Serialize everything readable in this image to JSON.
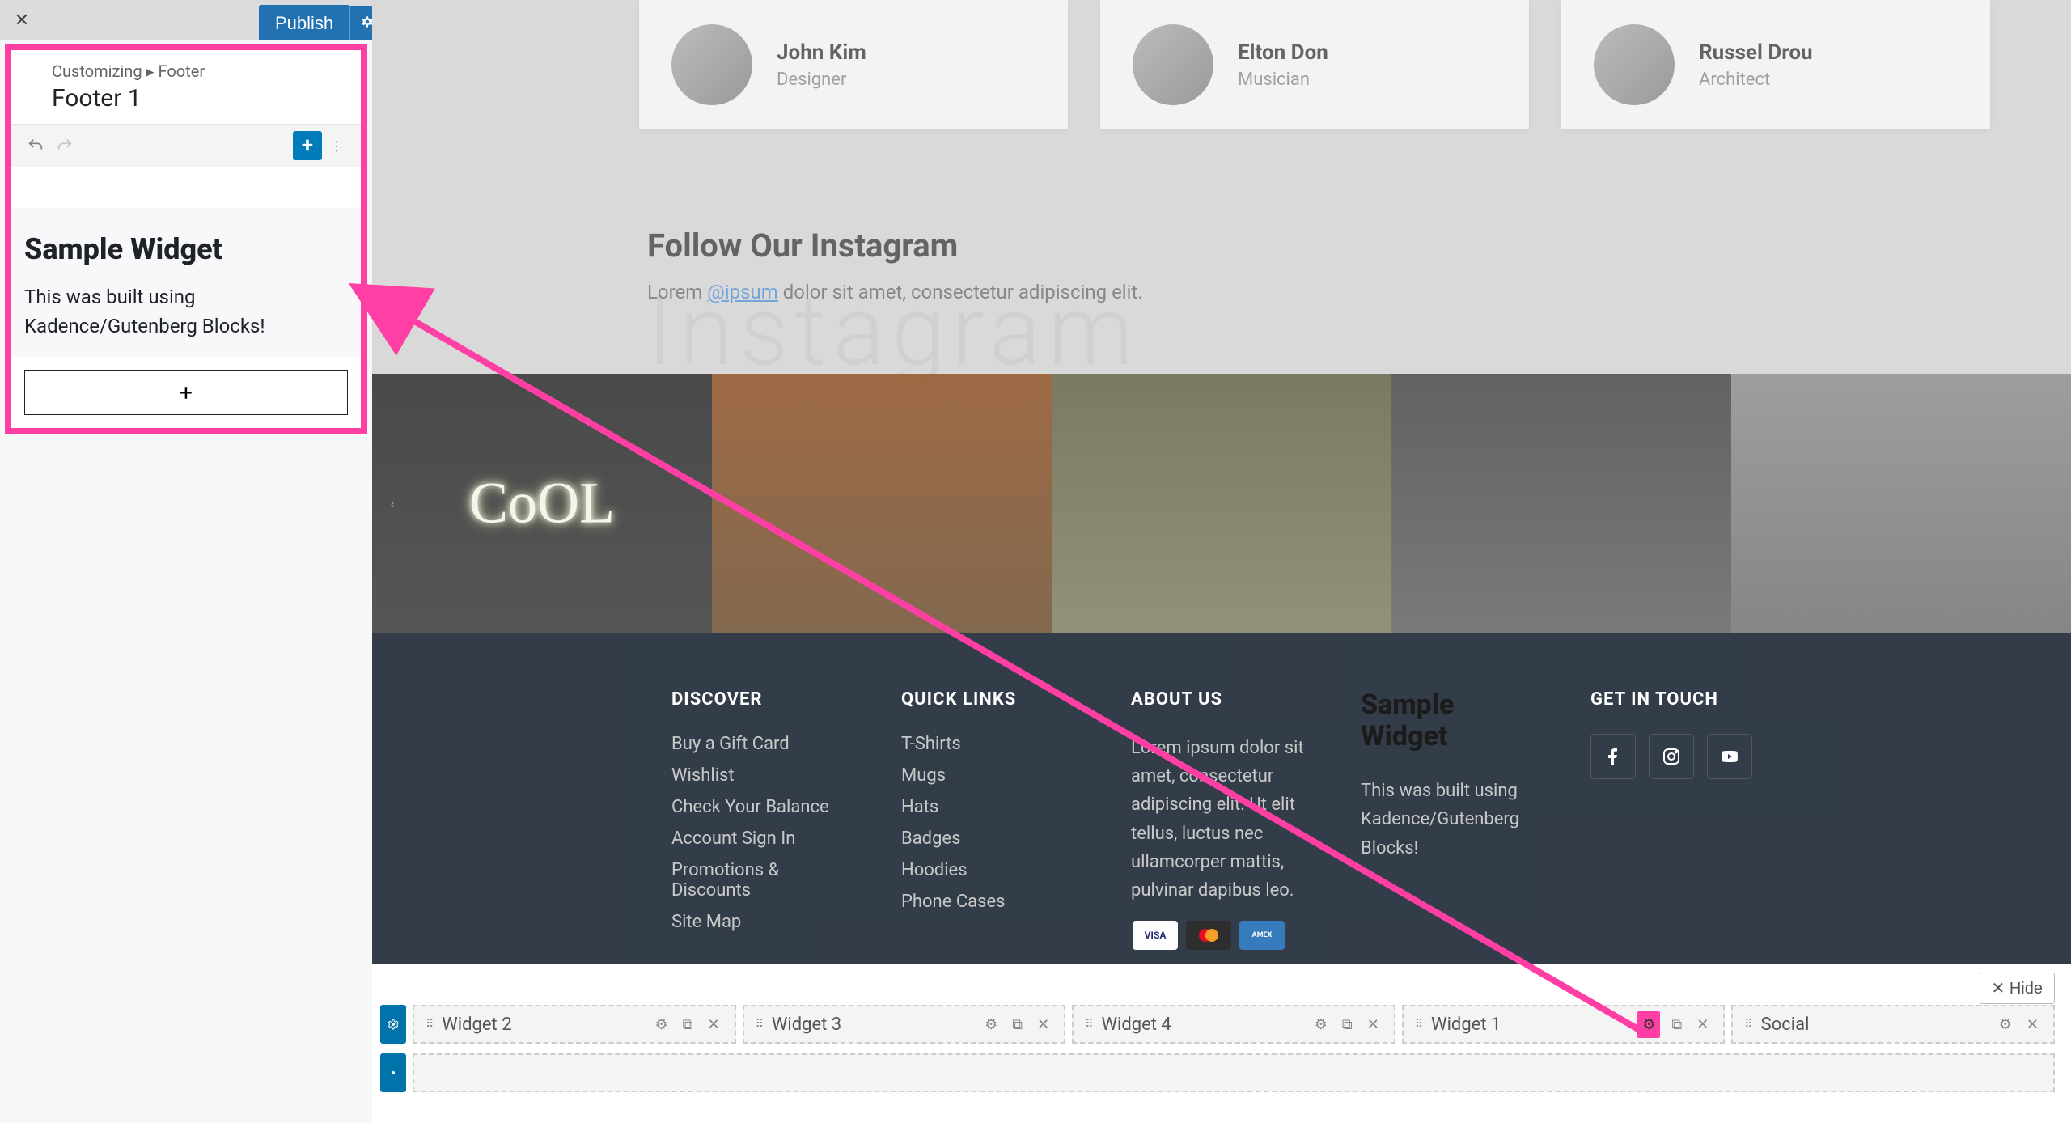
{
  "topbar": {
    "close": "✕",
    "publish": "Publish"
  },
  "sidebar": {
    "breadcrumb": "Customizing ▸ Footer",
    "title": "Footer 1",
    "widget_heading": "Sample Widget",
    "widget_body": "This was built using Kadence/Gutenberg Blocks!",
    "add_block": "+"
  },
  "team": [
    {
      "name": "John Kim",
      "role": "Designer"
    },
    {
      "name": "Elton Don",
      "role": "Musician"
    },
    {
      "name": "Russel Drou",
      "role": "Architect"
    }
  ],
  "instagram": {
    "heading": "Follow Our Instagram",
    "text_pre": "Lorem ",
    "link": "@ipsum",
    "text_post": " dolor sit amet, consectetur adipiscing elit.",
    "bg_text": "Instagram",
    "cool": "CoOL"
  },
  "footer": {
    "discover": {
      "title": "DISCOVER",
      "items": [
        "Buy a Gift Card",
        "Wishlist",
        "Check Your Balance",
        "Account Sign In",
        "Promotions & Discounts",
        "Site Map"
      ]
    },
    "quicklinks": {
      "title": "QUICK LINKS",
      "items": [
        "T-Shirts",
        "Mugs",
        "Hats",
        "Badges",
        "Hoodies",
        "Phone Cases"
      ]
    },
    "about": {
      "title": "ABOUT US",
      "text": "Lorem ipsum dolor sit amet, consectetur adipiscing elit. Ut elit tellus, luctus nec ullamcorper mattis, pulvinar dapibus leo."
    },
    "sample": {
      "title": "Sample Widget",
      "text": "This was built using Kadence/Gutenberg Blocks!"
    },
    "getintouch": {
      "title": "GET IN TOUCH"
    },
    "payments": {
      "visa": "VISA",
      "amex": "AMEX"
    }
  },
  "builder": {
    "hide": "✕ Hide",
    "widgets": [
      "Widget 2",
      "Widget 3",
      "Widget 4",
      "Widget 1",
      "Social"
    ]
  }
}
